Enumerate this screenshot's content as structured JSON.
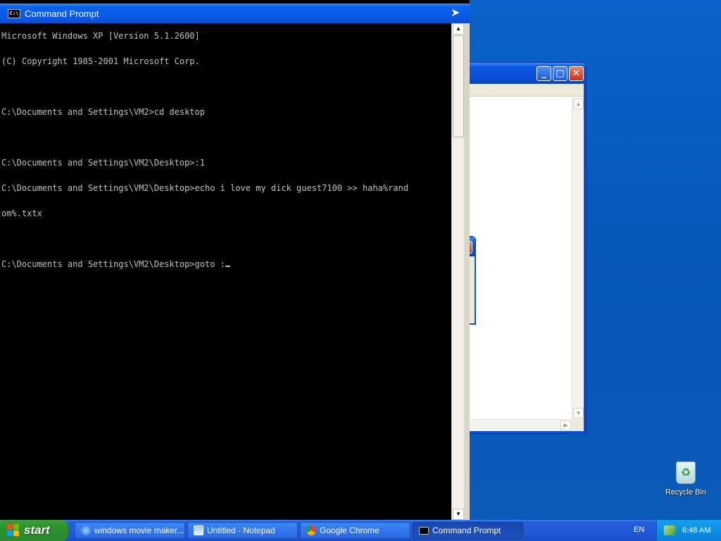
{
  "colors": {
    "desktop_blue": "#0a5ab8",
    "titlebar_blue": "#0a58e0",
    "console_bg": "#000000",
    "console_text": "#c0c0c0",
    "start_green": "#2b8f2b",
    "close_red": "#c8331e"
  },
  "cmd": {
    "title": "Command Prompt",
    "icon": "cmd-icon",
    "icon_text": "C:\\",
    "lines": [
      "Microsoft Windows XP [Version 5.1.2600]",
      "(C) Copyright 1985-2001 Microsoft Corp.",
      "",
      "C:\\Documents and Settings\\VM2>cd desktop",
      "",
      "C:\\Documents and Settings\\VM2\\Desktop>:1",
      "C:\\Documents and Settings\\VM2\\Desktop>echo i love my dick guest7100 >> haha%rand",
      "om%.txtx",
      "",
      "C:\\Documents and Settings\\VM2\\Desktop>goto :"
    ]
  },
  "bg_window": {
    "minimize_glyph": "_",
    "maximize_glyph": "□",
    "close_glyph": "✕"
  },
  "desktop": {
    "recycle_bin_label": "Recycle Bin"
  },
  "taskbar": {
    "start_label": "start",
    "buttons": [
      {
        "label": "windows movie maker...",
        "icon": "ie-icon",
        "active": false
      },
      {
        "label": "Untitled - Notepad",
        "icon": "notepad-icon",
        "active": false
      },
      {
        "label": "Google Chrome",
        "icon": "chrome-icon",
        "active": false
      },
      {
        "label": "Command Prompt",
        "icon": "cmd-icon",
        "active": true
      }
    ],
    "language": "EN",
    "clock": "6:48 AM"
  }
}
